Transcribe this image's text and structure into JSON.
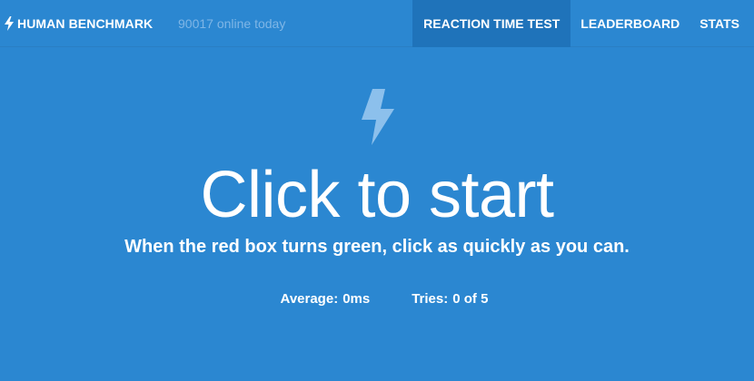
{
  "colors": {
    "background": "#2b87d1",
    "active_nav": "#1f73ba",
    "muted_text": "#7fb6e6",
    "bolt_faded": "#8cc0ec"
  },
  "header": {
    "brand_icon": "lightning-bolt-icon",
    "brand": "HUMAN BENCHMARK",
    "online": "90017 online today",
    "nav": [
      {
        "label": "REACTION TIME TEST",
        "active": true
      },
      {
        "label": "LEADERBOARD",
        "active": false
      },
      {
        "label": "STATS",
        "active": false
      }
    ]
  },
  "main": {
    "icon": "lightning-bolt-icon",
    "title": "Click to start",
    "subtitle": "When the red box turns green, click as quickly as you can.",
    "average_label": "Average:",
    "average_value": "0ms",
    "tries_label": "Tries:",
    "tries_value": "0 of 5"
  }
}
